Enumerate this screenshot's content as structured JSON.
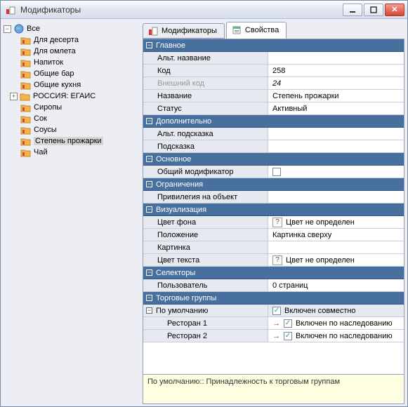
{
  "window": {
    "title": "Модификаторы"
  },
  "tree": {
    "root": "Все",
    "items": [
      {
        "label": "Для десерта"
      },
      {
        "label": "Для омлета"
      },
      {
        "label": "Напиток"
      },
      {
        "label": "Общие бар"
      },
      {
        "label": "Общие кухня"
      },
      {
        "label": "РОССИЯ: ЕГАИС",
        "hasChildren": true
      },
      {
        "label": "Сиропы"
      },
      {
        "label": "Сок"
      },
      {
        "label": "Соусы"
      },
      {
        "label": "Степень прожарки",
        "selected": true
      },
      {
        "label": "Чай"
      }
    ]
  },
  "tabs": {
    "modifiers": "Модификаторы",
    "properties": "Свойства"
  },
  "sections": {
    "main": "Главное",
    "additional": "Дополнительно",
    "base": "Основное",
    "restrictions": "Ограничения",
    "visual": "Визуализация",
    "selectors": "Селекторы",
    "tradegroups": "Торговые группы"
  },
  "props": {
    "alt_name": {
      "label": "Альт. название",
      "value": ""
    },
    "code": {
      "label": "Код",
      "value": "258"
    },
    "ext_code": {
      "label": "Внешний код",
      "value": "24"
    },
    "name": {
      "label": "Название",
      "value": "Степень прожарки"
    },
    "status": {
      "label": "Статус",
      "value": "Активный"
    },
    "alt_hint": {
      "label": "Альт. подсказка",
      "value": ""
    },
    "hint": {
      "label": "Подсказка",
      "value": ""
    },
    "common_mod": {
      "label": "Общий модификатор",
      "checked": false
    },
    "privilege": {
      "label": "Привилегия на объект",
      "value": ""
    },
    "bg": {
      "label": "Цвет фона",
      "value": "Цвет не определен"
    },
    "position": {
      "label": "Положение",
      "value": "Картинка сверху"
    },
    "picture": {
      "label": "Картинка",
      "value": ""
    },
    "textcolor": {
      "label": "Цвет текста",
      "value": "Цвет не определен"
    },
    "user": {
      "label": "Пользователь",
      "value": "0 страниц"
    }
  },
  "tradegroup": {
    "default": {
      "label": "По умолчанию",
      "value": "Включен совместно"
    },
    "r1": {
      "label": "Ресторан 1",
      "value": "Включен по наследованию"
    },
    "r2": {
      "label": "Ресторан 2",
      "value": "Включен по наследованию"
    }
  },
  "hintbox": "По умолчанию:: Принадлежность к торговым группам"
}
